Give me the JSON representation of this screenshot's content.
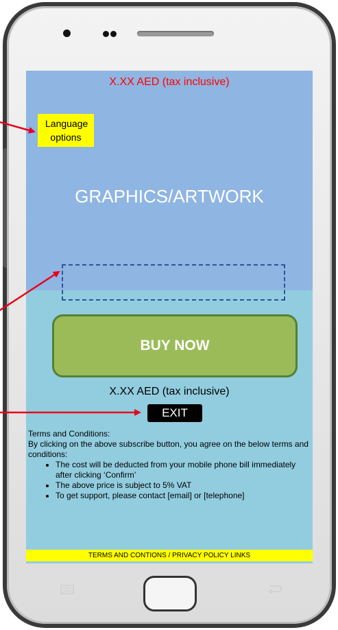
{
  "screen": {
    "price_top": "X.XX AED  (tax inclusive)",
    "language_button": "Language options",
    "graphics_placeholder": "GRAPHICS/ARTWORK",
    "buy_button": "BUY NOW",
    "price_bottom": "X.XX AED  (tax inclusive)",
    "exit_button": "EXIT",
    "terms": {
      "heading": "Terms and Conditions:",
      "intro": "By clicking on the above subscribe button, you agree on the below terms and conditions:",
      "items": [
        "The cost will be deducted from your mobile phone bill immediately after clicking ‘Confirm’",
        "The above price is subject to 5% VAT",
        "To get support, please contact [email] or [telephone]"
      ]
    },
    "footer_link": "TERMS AND CONTIONS / PRIVACY POLICY LINKS"
  },
  "colors": {
    "screen_top": "#8fb5e2",
    "screen_bottom": "#92cddf",
    "price_top": "#ff0000",
    "language_button": "#ffff00",
    "buy_button": "#9bbb59",
    "buy_button_border": "#548235",
    "exit_button": "#000000",
    "footer_bar": "#ffff00",
    "annotation_arrows": "#e8001c"
  },
  "icons": [
    "camera-icon",
    "menu-icon",
    "home-button",
    "back-icon",
    "annotation-arrow"
  ]
}
